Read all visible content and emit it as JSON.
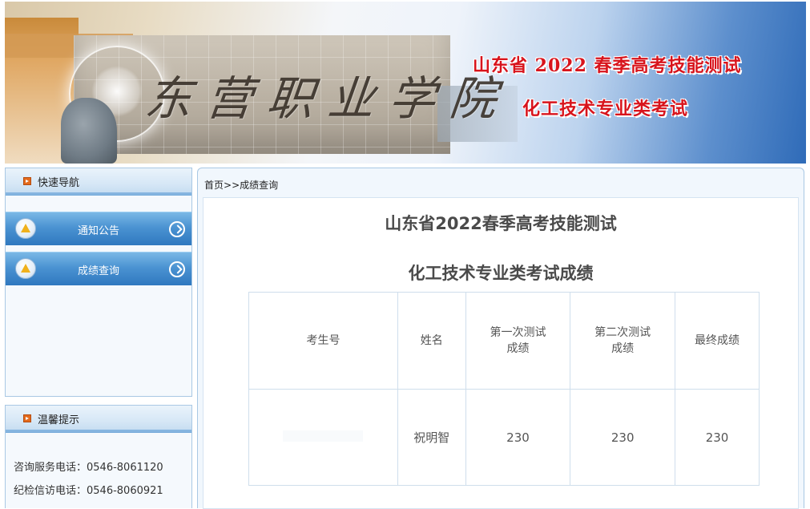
{
  "banner": {
    "calligraphy": "东营职业学院",
    "title_line1": "山东省 2022 春季高考技能测试",
    "title_line2": "化工技术专业类考试"
  },
  "sidebar": {
    "nav_title": "快速导航",
    "nav_items": [
      {
        "label": "通知公告",
        "icon": "notice-icon"
      },
      {
        "label": "成绩查询",
        "icon": "score-query-icon"
      }
    ],
    "tips_title": "温馨提示",
    "tips": [
      "咨询服务电话：0546-8061120",
      "纪检信访电话：0546-8060921"
    ]
  },
  "main": {
    "breadcrumb": {
      "home": "首页",
      "separator": ">>",
      "current": "成绩查询"
    },
    "title1": "山东省2022春季高考技能测试",
    "title2": "化工技术专业类考试成绩",
    "table": {
      "headers": [
        "考生号",
        "姓名",
        "第一次测试成绩",
        "第二次测试成绩",
        "最终成绩"
      ],
      "header_lines": [
        [
          "考生号"
        ],
        [
          "姓名"
        ],
        [
          "第一次测试",
          "成绩"
        ],
        [
          "第二次测试",
          "成绩"
        ],
        [
          "最终成绩"
        ]
      ],
      "rows": [
        {
          "exam_id": "",
          "name": "祝明智",
          "first": "230",
          "second": "230",
          "final": "230"
        }
      ]
    }
  },
  "colors": {
    "banner_title": "#d8141c",
    "nav_blue": "#4b93d2",
    "border_blue": "#a9c8e4",
    "bullet_orange": "#e46a1c"
  }
}
